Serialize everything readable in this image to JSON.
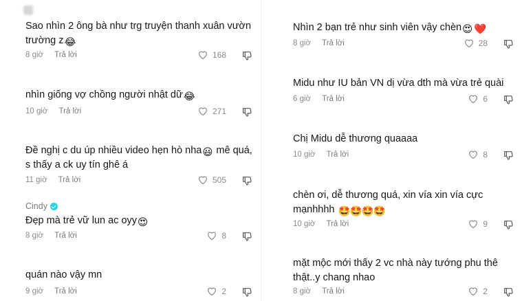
{
  "left": [
    {
      "text": "Sao nhìn 2 ông bà như trg truyện thanh xuân vườn trường z",
      "emoji": [
        "😂"
      ],
      "time": "8 giờ",
      "reply": "Trả lời",
      "likes": "168"
    },
    {
      "text": "nhìn giống vợ chồng người nhật dữ",
      "emoji": [
        "😂"
      ],
      "time": "10 giờ",
      "reply": "Trả lời",
      "likes": "271"
    },
    {
      "text": "Đề nghị c du úp nhiều video hẹn hò nha",
      "text2": " mê quá, s thấy a ck uy tín ghê á",
      "emoji_mid": "😃",
      "time": "11 giờ",
      "reply": "Trả lời",
      "likes": "505"
    },
    {
      "author": "Cindy",
      "text": "Đẹp mà trẻ vữ lun ac oyy",
      "emoji": [
        "😍"
      ],
      "time": "8 giờ",
      "reply": "Trả lời",
      "likes": "8"
    },
    {
      "text": "quán nào vậy mn",
      "emoji": [],
      "time": "9 giờ",
      "reply": "Trả lời",
      "likes": "2"
    }
  ],
  "right": [
    {
      "text": "Nhìn 2 bạn trẻ như sinh viên vậy chèn",
      "emoji": [
        "😍",
        "❤️"
      ],
      "time": "8 giờ",
      "reply": "Trả lời",
      "likes": "28"
    },
    {
      "text": "Midu như IU bản VN dị vừa dth mà vừa trẻ quài",
      "emoji": [],
      "time": "6 giờ",
      "reply": "Trả lời",
      "likes": "6"
    },
    {
      "text": "Chị Midu dễ thương quaaaa",
      "emoji": [],
      "time": "10 giờ",
      "reply": "Trả lời",
      "likes": "8"
    },
    {
      "text": "chèn ơi, dễ thương quá, xin vía xin vía cực mạnhhhh",
      "emoji": [
        "🤩",
        "🤩",
        "🤩",
        "🤩"
      ],
      "time": "10 giờ",
      "reply": "Trả lời",
      "likes": "9"
    },
    {
      "text": "mặt mộc mới thấy 2 vc nhà này tướng phu thê thật..y chang nhao",
      "emoji": [],
      "time": "8 giờ",
      "reply": "Trả lời",
      "likes": "2"
    }
  ],
  "colors": {
    "verified": "#20d5ec",
    "text": "#161616",
    "meta": "#8a8a8a"
  },
  "icons": {
    "like": "heart-outline-icon",
    "dislike": "thumbs-down-icon",
    "verified": "verified-check-icon"
  }
}
